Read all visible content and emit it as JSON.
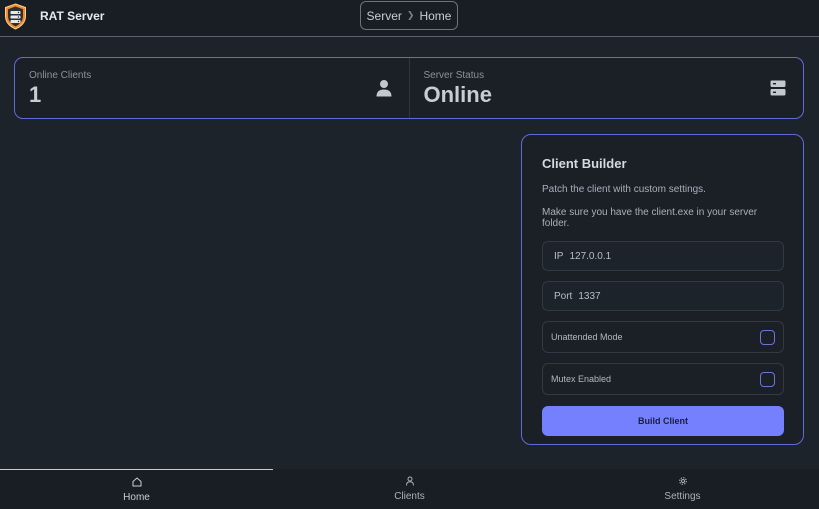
{
  "header": {
    "app_title": "RAT Server",
    "logo_icon": "server-shield-logo",
    "breadcrumb": [
      "Server",
      "Home"
    ]
  },
  "stats": [
    {
      "title": "Online Clients",
      "value": "1",
      "icon": "user-icon"
    },
    {
      "title": "Server Status",
      "value": "Online",
      "icon": "server-icon"
    }
  ],
  "builder": {
    "title": "Client Builder",
    "desc1": "Patch the client with custom settings.",
    "desc2": "Make sure you have the client.exe in your server folder.",
    "ip_label": "IP",
    "ip_value": "127.0.0.1",
    "port_label": "Port",
    "port_value": "1337",
    "unattended_label": "Unattended Mode",
    "unattended_checked": false,
    "mutex_label": "Mutex Enabled",
    "mutex_checked": false,
    "build_label": "Build Client"
  },
  "nav": [
    {
      "label": "Home",
      "icon": "home-icon",
      "active": true
    },
    {
      "label": "Clients",
      "icon": "user-icon",
      "active": false
    },
    {
      "label": "Settings",
      "icon": "gear-icon",
      "active": false
    }
  ],
  "colors": {
    "accent": "#7480ff",
    "background": "#1d232a",
    "logo_orange": "#f08c2b"
  }
}
